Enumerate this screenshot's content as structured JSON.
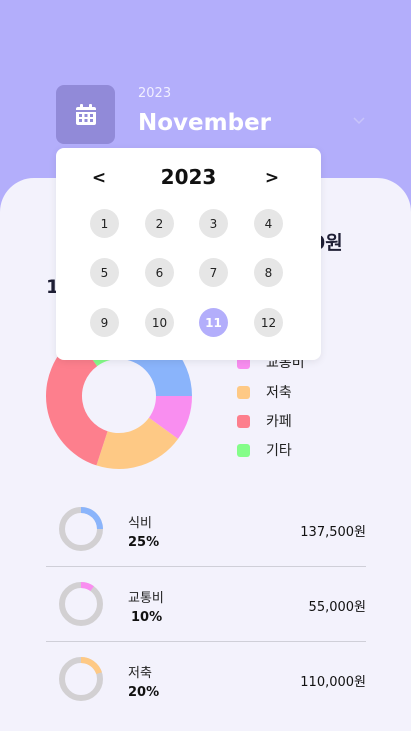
{
  "header": {
    "year": "2023",
    "month": "November",
    "calendar_icon": "calendar-icon",
    "dropdown_icon": "chevron-down-icon"
  },
  "summary": {
    "total_partial": "0원",
    "count_partial": "1"
  },
  "chart_data": {
    "type": "pie",
    "donut": true,
    "slices": [
      {
        "label": "식비",
        "value": 25,
        "color": "#8ab4fb"
      },
      {
        "label": "교통비",
        "value": 10,
        "color": "#f98ef0"
      },
      {
        "label": "저축",
        "value": 20,
        "color": "#fec985"
      },
      {
        "label": "카페",
        "value": 35,
        "color": "#fd7f8d"
      },
      {
        "label": "기타",
        "value": 10,
        "color": "#84fd89"
      }
    ]
  },
  "legend": [
    {
      "label": "교통비",
      "color": "#f98ef0"
    },
    {
      "label": "저축",
      "color": "#fec985"
    },
    {
      "label": "카페",
      "color": "#fd7f8d"
    },
    {
      "label": "기타",
      "color": "#84fd89"
    }
  ],
  "list": [
    {
      "name": "식비",
      "percent": "25%",
      "amount": "137,500원",
      "fraction": 0.25,
      "color": "#8ab4fb"
    },
    {
      "name": "교통비",
      "percent": "10%",
      "amount": "55,000원",
      "fraction": 0.1,
      "color": "#f98ef0"
    },
    {
      "name": "저축",
      "percent": "20%",
      "amount": "110,000원",
      "fraction": 0.2,
      "color": "#fec985"
    }
  ],
  "picker": {
    "year": "2023",
    "prev": "<",
    "next": ">",
    "months": [
      "1",
      "2",
      "3",
      "4",
      "5",
      "6",
      "7",
      "8",
      "9",
      "10",
      "11",
      "12"
    ],
    "selected": "11",
    "accent": "#b3aefb"
  }
}
